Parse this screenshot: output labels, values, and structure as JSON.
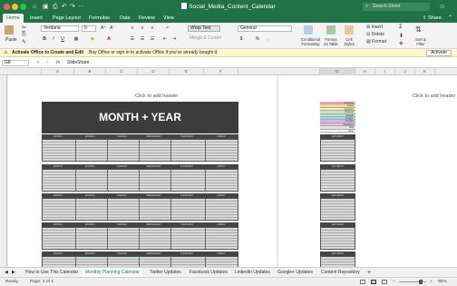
{
  "window": {
    "title": "Social_Media_Content_Calendar",
    "search_placeholder": "Search Sheet",
    "share_label": "Share"
  },
  "ribbon_tabs": [
    "Home",
    "Insert",
    "Page Layout",
    "Formulas",
    "Data",
    "Review",
    "View"
  ],
  "ribbon": {
    "paste": "Paste",
    "font_name": "Verdana",
    "font_size": "9",
    "bold": "B",
    "italic": "I",
    "underline": "U",
    "wrap_text": "Wrap Text",
    "merge_center": "Merge & Center",
    "number_format": "General",
    "currency": "$",
    "percent": "%",
    "comma": ",",
    "cond_format": "Conditional Formatting",
    "format_table": "Format as Table",
    "cell_styles": "Cell Styles",
    "insert": "Insert",
    "delete": "Delete",
    "format": "Format",
    "sum": "Σ",
    "sort_filter": "Sort & Filter"
  },
  "activation": {
    "message_bold": "Activate Office to Create and Edit",
    "message": "Buy Office or sign in to activate Office if you've already bought it.",
    "button": "Activate"
  },
  "formula_bar": {
    "name_box": "G8",
    "fx": "fx",
    "value": "SlideShare"
  },
  "columns": [
    "A",
    "B",
    "C",
    "D",
    "E",
    "F",
    "G",
    "H",
    "I",
    "J",
    "K"
  ],
  "sheet": {
    "header_left": "Click to add header",
    "header_right": "Click to add header",
    "calendar_title": "MONTH + YEAR",
    "day_names": [
      "SUNDAY",
      "MONDAY",
      "TUESDAY",
      "WEDNESDAY",
      "THURSDAY",
      "FRIDAY"
    ],
    "saturday": "SATURDAY",
    "legend": [
      "Facebook",
      "Twitter",
      "Instagram",
      "Pinterest",
      "LinkedIn",
      "Google+",
      "YouTube",
      "SlideShare",
      "Blog",
      "Other"
    ],
    "legend_colors": [
      "#f7a8a0",
      "#fbd5a0",
      "#fff4a3",
      "#c7e8b0",
      "#a8e6d6",
      "#a9d0f0",
      "#c8b8ef",
      "#f0b8e0",
      "#e0e0e0",
      "#ffffff"
    ]
  },
  "sheet_tabs": [
    "How to Use This Calendar",
    "Monthly Planning Calendar",
    "Twitter Updates",
    "Facebook Updates",
    "LinkedIn Updates",
    "Google+ Updates",
    "Content Repository"
  ],
  "status": {
    "ready": "Ready",
    "page": "Page: 2 of 2",
    "zoom": "80%",
    "minus": "−",
    "plus": "+"
  }
}
